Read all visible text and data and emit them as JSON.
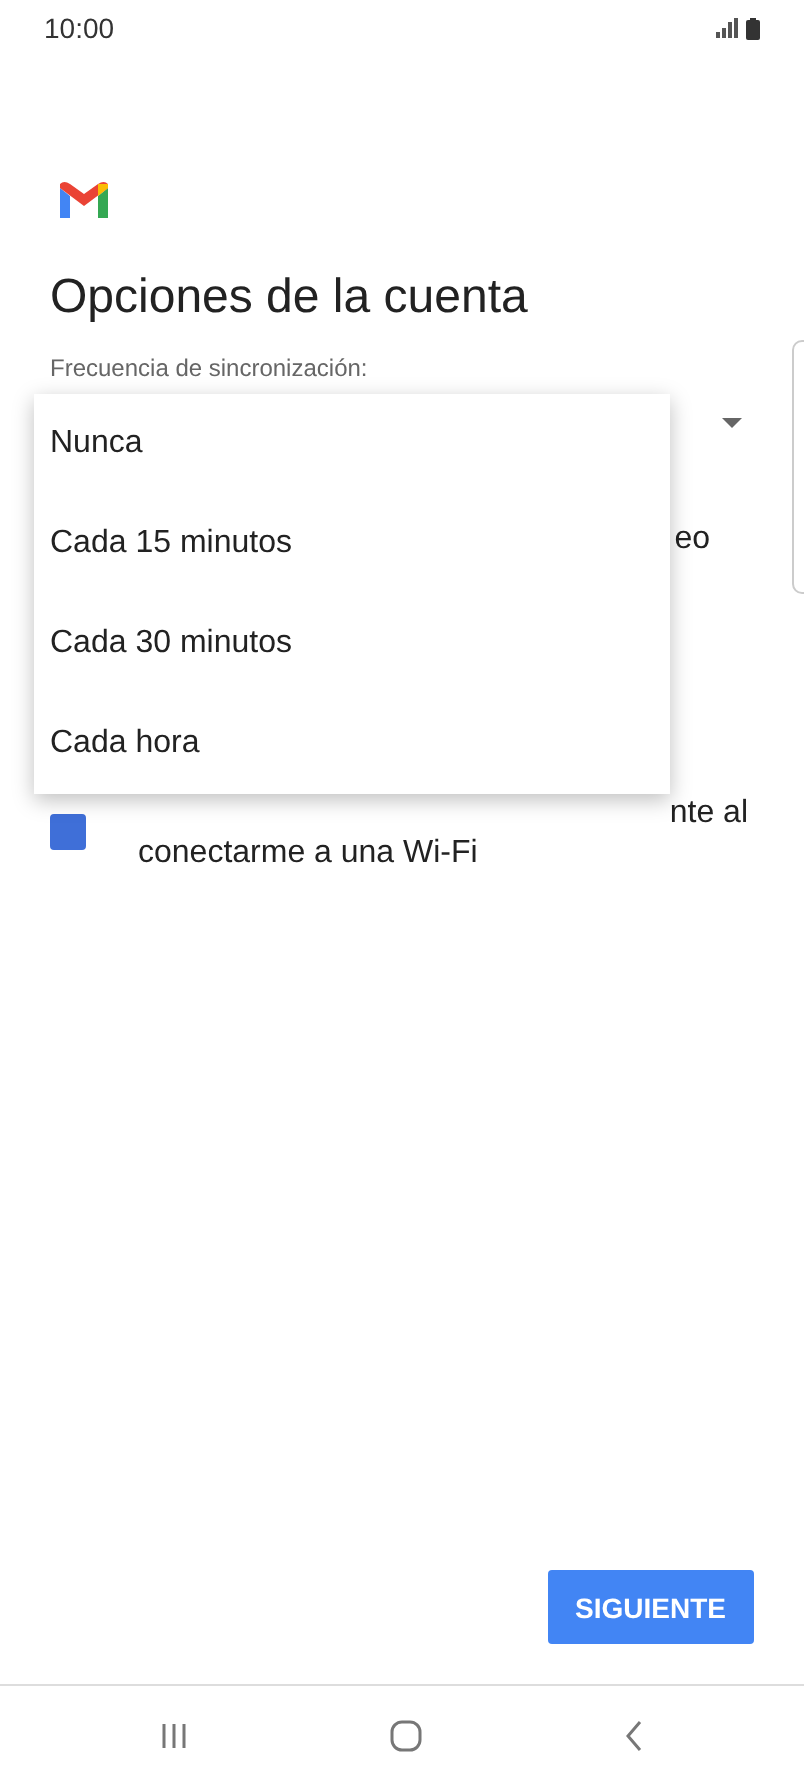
{
  "status_bar": {
    "time": "10:00"
  },
  "title": "Opciones de la cuenta",
  "sync_field": {
    "label": "Frecuencia de sincronización:"
  },
  "options": [
    {
      "text_fragments": [
        "eo"
      ]
    },
    {
      "checked": true,
      "text_fragments": [
        "nte al",
        "conectarme a una Wi-Fi"
      ]
    }
  ],
  "dropdown_menu": {
    "items": [
      {
        "label": "Nunca"
      },
      {
        "label": "Cada 15 minutos"
      },
      {
        "label": "Cada 30 minutos"
      },
      {
        "label": "Cada hora"
      }
    ]
  },
  "next_button": "SIGUIENTE"
}
